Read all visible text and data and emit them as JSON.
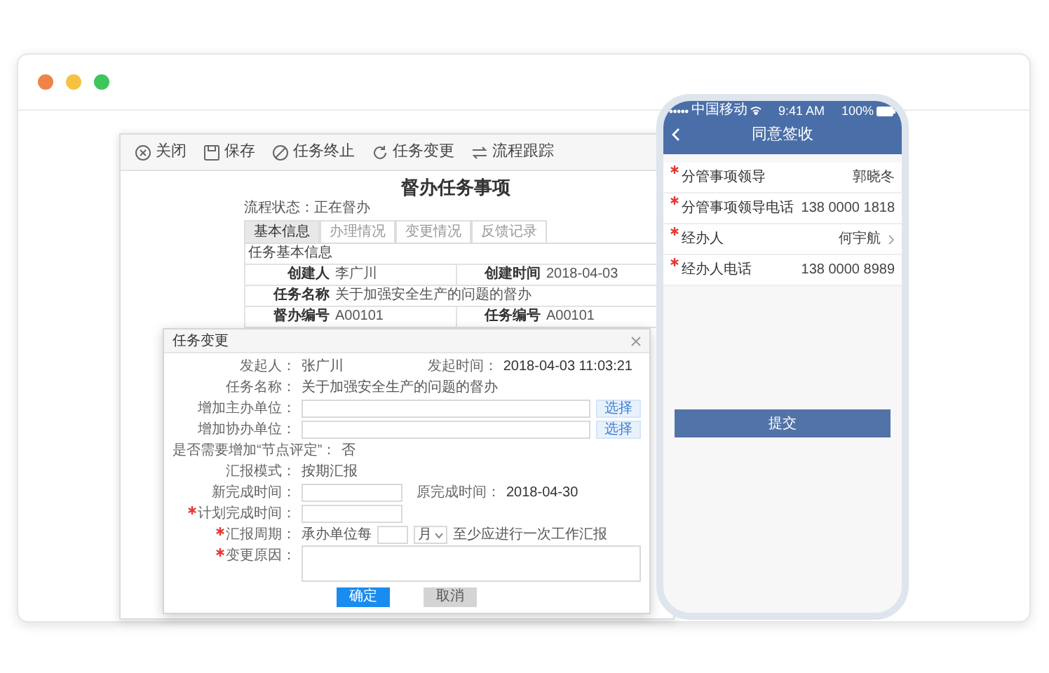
{
  "browser_frame": {
    "window_controls": [
      {
        "color": "#f0834a"
      },
      {
        "color": "#f5c242"
      },
      {
        "color": "#3ec65a"
      }
    ]
  },
  "desktop_app": {
    "toolbar": [
      {
        "kind": "close",
        "label": "关闭"
      },
      {
        "kind": "save",
        "label": "保存"
      },
      {
        "kind": "stop",
        "label": "任务终止"
      },
      {
        "kind": "change",
        "label": "任务变更"
      },
      {
        "kind": "flow",
        "label": "流程跟踪"
      }
    ],
    "title": "督办任务事项",
    "status": "流程状态：正在督办",
    "tabs": [
      {
        "label": "基本信息",
        "selected": true
      },
      {
        "label": "办理情况",
        "selected": false
      },
      {
        "label": "变更情况",
        "selected": false
      },
      {
        "label": "反馈记录",
        "selected": false
      }
    ],
    "section_title": "任务基本信息",
    "info_rows": [
      [
        {
          "label": "创建人",
          "value": "李广川"
        },
        {
          "label": "创建时间",
          "value": "2018-04-03"
        }
      ],
      [
        {
          "label": "任务名称",
          "value": "关于加强安全生产的问题的督办"
        }
      ],
      [
        {
          "label": "督办编号",
          "value": "A00101"
        },
        {
          "label": "任务编号",
          "value": "A00101"
        }
      ]
    ],
    "dialog": {
      "title": "任务变更",
      "fields": [
        {
          "kind": "pair",
          "required": false,
          "label": "发起人：",
          "value": "张广川",
          "label2": "发起时间：",
          "value2": "2018-04-03 11:03:21"
        },
        {
          "kind": "static",
          "required": false,
          "label": "任务名称：",
          "value": "关于加强安全生产的问题的督办"
        },
        {
          "kind": "picker",
          "required": false,
          "label": "增加主办单位：",
          "button": "选择"
        },
        {
          "kind": "picker",
          "required": false,
          "label": "增加协办单位：",
          "button": "选择"
        },
        {
          "kind": "static",
          "required": false,
          "label": "是否需要增加“节点评定”：",
          "value": "否"
        },
        {
          "kind": "static",
          "required": false,
          "label": "汇报模式：",
          "value": "按期汇报"
        },
        {
          "kind": "input_pair",
          "required": false,
          "label": "新完成时间：",
          "label2": "原完成时间：",
          "value2": "2018-04-30"
        },
        {
          "kind": "input",
          "required": true,
          "label": "计划完成时间："
        },
        {
          "kind": "period",
          "required": true,
          "label": "汇报周期：",
          "prefix": "承办单位每",
          "unit": "月",
          "suffix": "至少应进行一次工作汇报"
        },
        {
          "kind": "textarea",
          "required": true,
          "label": "变更原因："
        }
      ],
      "buttons": [
        {
          "label": "确定",
          "kind": "primary"
        },
        {
          "label": "取消",
          "kind": "disabled"
        }
      ]
    }
  },
  "mobile_app": {
    "status_bar": {
      "carrier": "中国移动",
      "time": "9:41 AM",
      "battery": "100%"
    },
    "title": "同意签收",
    "rows": [
      {
        "label": "分管事项领导",
        "value": "郭晓冬",
        "required": true,
        "kind": "text"
      },
      {
        "label": "分管事项领导电话",
        "value": "138 0000 1818",
        "required": true,
        "kind": "text"
      },
      {
        "label": "经办人",
        "value": "何宇航",
        "required": true,
        "kind": "link"
      },
      {
        "label": "经办人电话",
        "value": "138 0000 8989",
        "required": true,
        "kind": "text"
      }
    ],
    "submit": "提交"
  }
}
